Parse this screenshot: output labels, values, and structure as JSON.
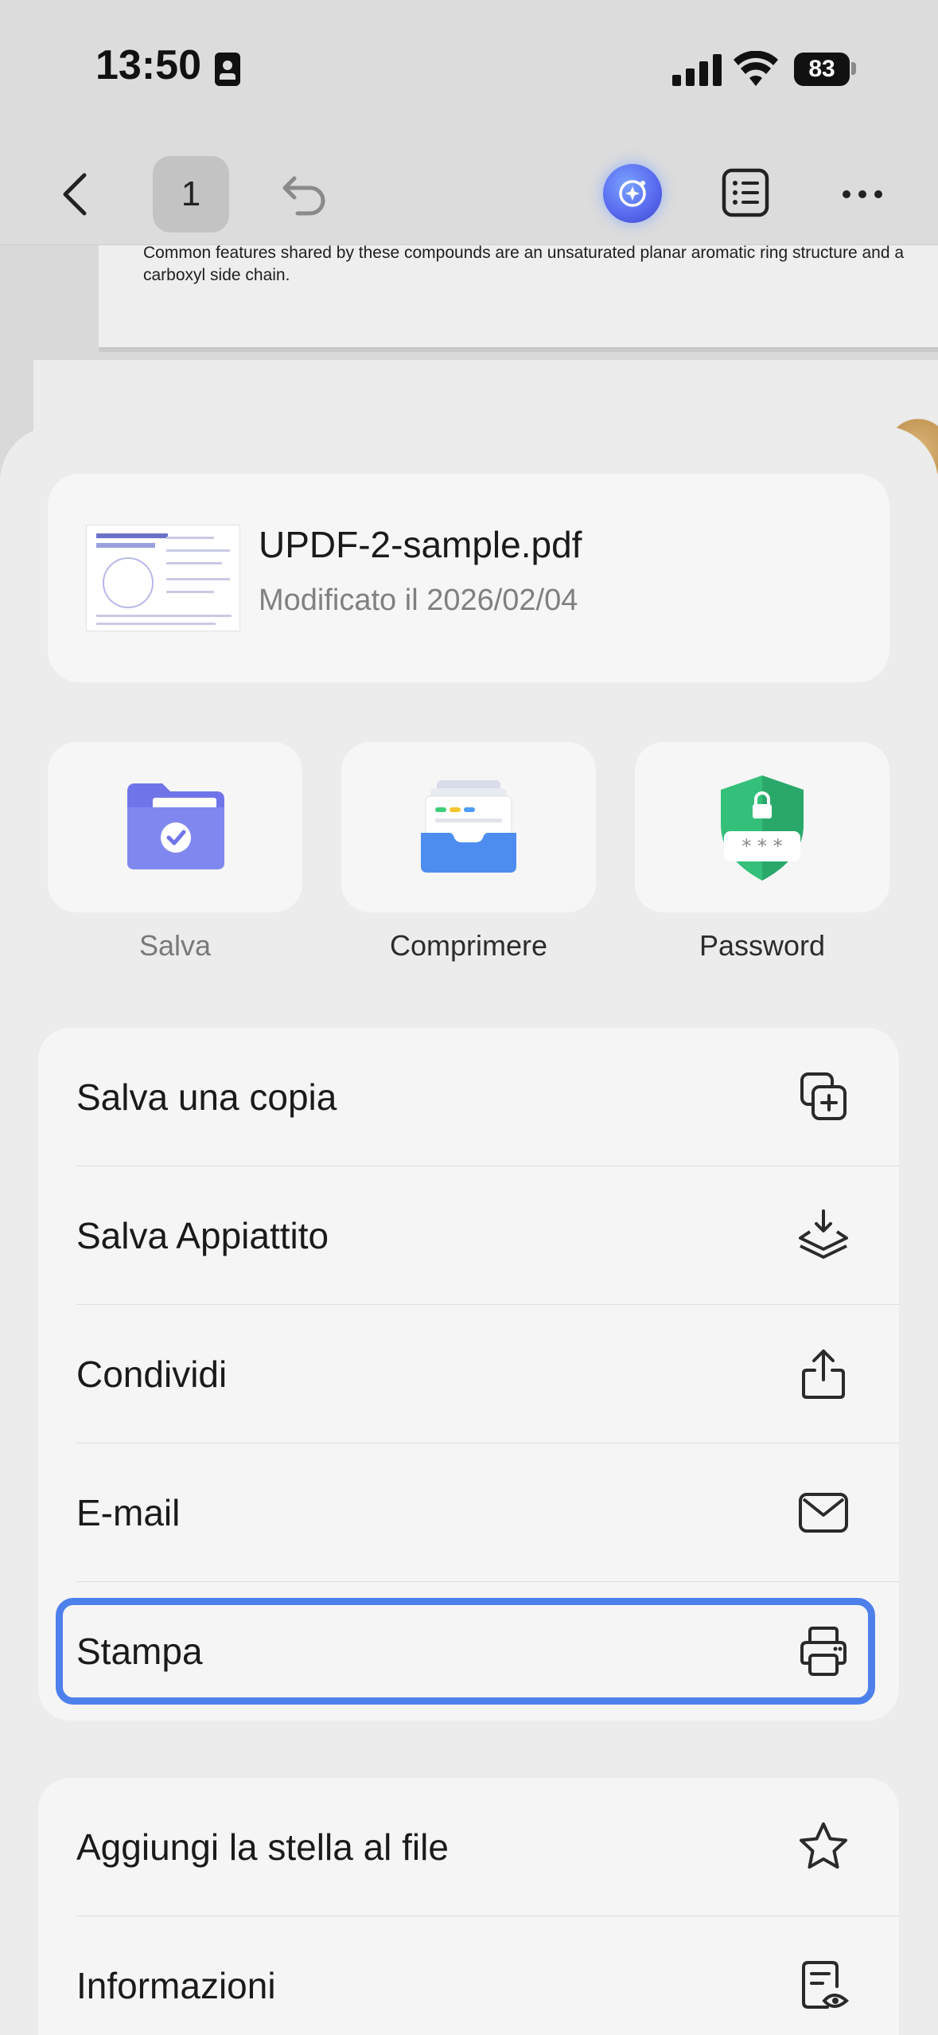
{
  "status_bar": {
    "time": "13:50",
    "battery": "83"
  },
  "toolbar": {
    "page_number": "1"
  },
  "document": {
    "visible_text": "Common features shared by these compounds are an unsaturated planar aromatic ring structure and a carboxyl side chain."
  },
  "file": {
    "name": "UPDF-2-sample.pdf",
    "modified": "Modificato il 2026/02/04"
  },
  "actions": [
    {
      "label": "Salva",
      "icon": "folder-check-icon"
    },
    {
      "label": "Comprimere",
      "icon": "file-tray-icon"
    },
    {
      "label": "Password",
      "icon": "shield-lock-icon"
    }
  ],
  "menu_group_1": [
    {
      "label": "Salva una copia",
      "icon": "copy-plus-icon"
    },
    {
      "label": "Salva Appiattito",
      "icon": "layers-download-icon"
    },
    {
      "label": "Condividi",
      "icon": "share-icon"
    },
    {
      "label": "E-mail",
      "icon": "mail-icon"
    },
    {
      "label": "Stampa",
      "icon": "printer-icon",
      "highlighted": true
    }
  ],
  "menu_group_2": [
    {
      "label": "Aggiungi la stella al file",
      "icon": "star-icon"
    },
    {
      "label": "Informazioni",
      "icon": "file-info-icon"
    }
  ],
  "colors": {
    "highlight": "#4e80ec",
    "accent_blue": "#5a6cf0",
    "shield_green": "#34c07a"
  }
}
